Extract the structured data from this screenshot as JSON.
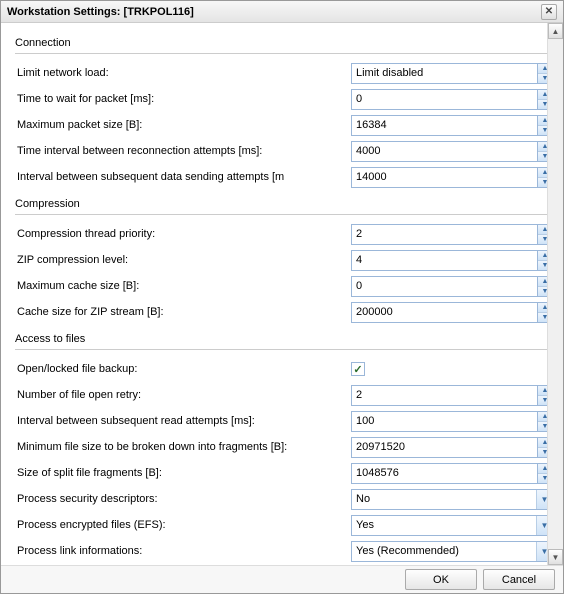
{
  "window": {
    "title": "Workstation Settings: [TRKPOL116]"
  },
  "sections": {
    "connection": {
      "title": "Connection",
      "limit_network_load_label": "Limit network load:",
      "limit_network_load_value": "Limit disabled",
      "time_wait_packet_label": "Time to wait for packet [ms]:",
      "time_wait_packet_value": "0",
      "max_packet_size_label": "Maximum packet size [B]:",
      "max_packet_size_value": "16384",
      "reconnect_interval_label": "Time interval between reconnection attempts [ms]:",
      "reconnect_interval_value": "4000",
      "send_interval_label": "Interval between subsequent data sending attempts [m",
      "send_interval_value": "14000"
    },
    "compression": {
      "title": "Compression",
      "thread_priority_label": "Compression thread priority:",
      "thread_priority_value": "2",
      "zip_level_label": "ZIP compression level:",
      "zip_level_value": "4",
      "max_cache_label": "Maximum cache size [B]:",
      "max_cache_value": "0",
      "zip_cache_label": "Cache size for ZIP stream [B]:",
      "zip_cache_value": "200000"
    },
    "access": {
      "title": "Access to files",
      "open_locked_label": "Open/locked file backup:",
      "open_locked_checked": true,
      "num_retry_label": "Number of file open retry:",
      "num_retry_value": "2",
      "read_interval_label": "Interval between subsequent read attempts [ms]:",
      "read_interval_value": "100",
      "min_frag_label": "Minimum file size to be broken down into fragments [B]:",
      "min_frag_value": "20971520",
      "split_size_label": "Size of split file fragments [B]:",
      "split_size_value": "1048576",
      "sec_desc_label": "Process security descriptors:",
      "sec_desc_value": "No",
      "efs_label": "Process encrypted files (EFS):",
      "efs_value": "Yes",
      "link_label": "Process link informations:",
      "link_value": "Yes (Recommended)"
    }
  },
  "footer": {
    "ok": "OK",
    "cancel": "Cancel"
  }
}
